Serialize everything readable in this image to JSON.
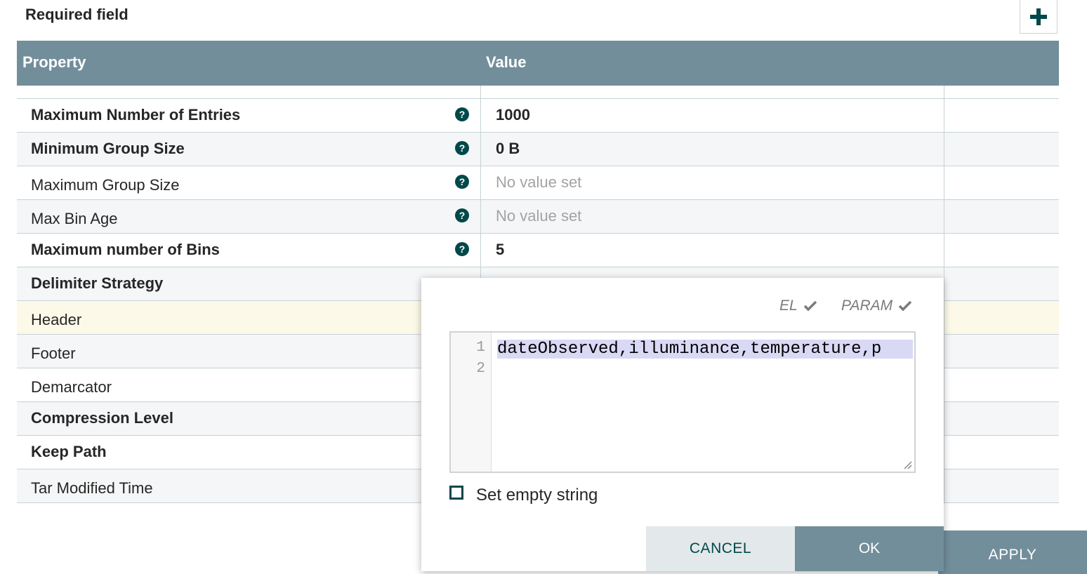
{
  "header": {
    "required_label": "Required field",
    "add_icon": "plus-icon"
  },
  "table": {
    "columns": [
      "Property",
      "Value"
    ],
    "rows": [
      {
        "name": "Maximum Number of Entries",
        "required": true,
        "value": "1000",
        "has_help": true
      },
      {
        "name": "Minimum Group Size",
        "required": true,
        "value": "0 B",
        "has_help": true
      },
      {
        "name": "Maximum Group Size",
        "required": false,
        "value": "No value set",
        "has_help": true
      },
      {
        "name": "Max Bin Age",
        "required": false,
        "value": "No value set",
        "has_help": true
      },
      {
        "name": "Maximum number of Bins",
        "required": true,
        "value": "5",
        "has_help": true
      },
      {
        "name": "Delimiter Strategy",
        "required": true,
        "value": "",
        "has_help": false
      },
      {
        "name": "Header",
        "required": false,
        "value": "",
        "has_help": false
      },
      {
        "name": "Footer",
        "required": false,
        "value": "",
        "has_help": false
      },
      {
        "name": "Demarcator",
        "required": false,
        "value": "",
        "has_help": false
      },
      {
        "name": "Compression Level",
        "required": true,
        "value": "",
        "has_help": false
      },
      {
        "name": "Keep Path",
        "required": true,
        "value": "",
        "has_help": false
      },
      {
        "name": "Tar Modified Time",
        "required": false,
        "value": "",
        "has_help": false
      }
    ]
  },
  "editor_popup": {
    "el_label": "EL",
    "param_label": "PARAM",
    "line_numbers": [
      "1",
      "2"
    ],
    "code": "dateObserved,illuminance,temperature,p",
    "empty_string_label": "Set empty string",
    "cancel_label": "CANCEL",
    "ok_label": "OK"
  },
  "footer": {
    "apply_label": "APPLY"
  },
  "colors": {
    "header_bg": "#728e9b",
    "accent": "#004849",
    "highlight_row": "#fdf9e8"
  }
}
